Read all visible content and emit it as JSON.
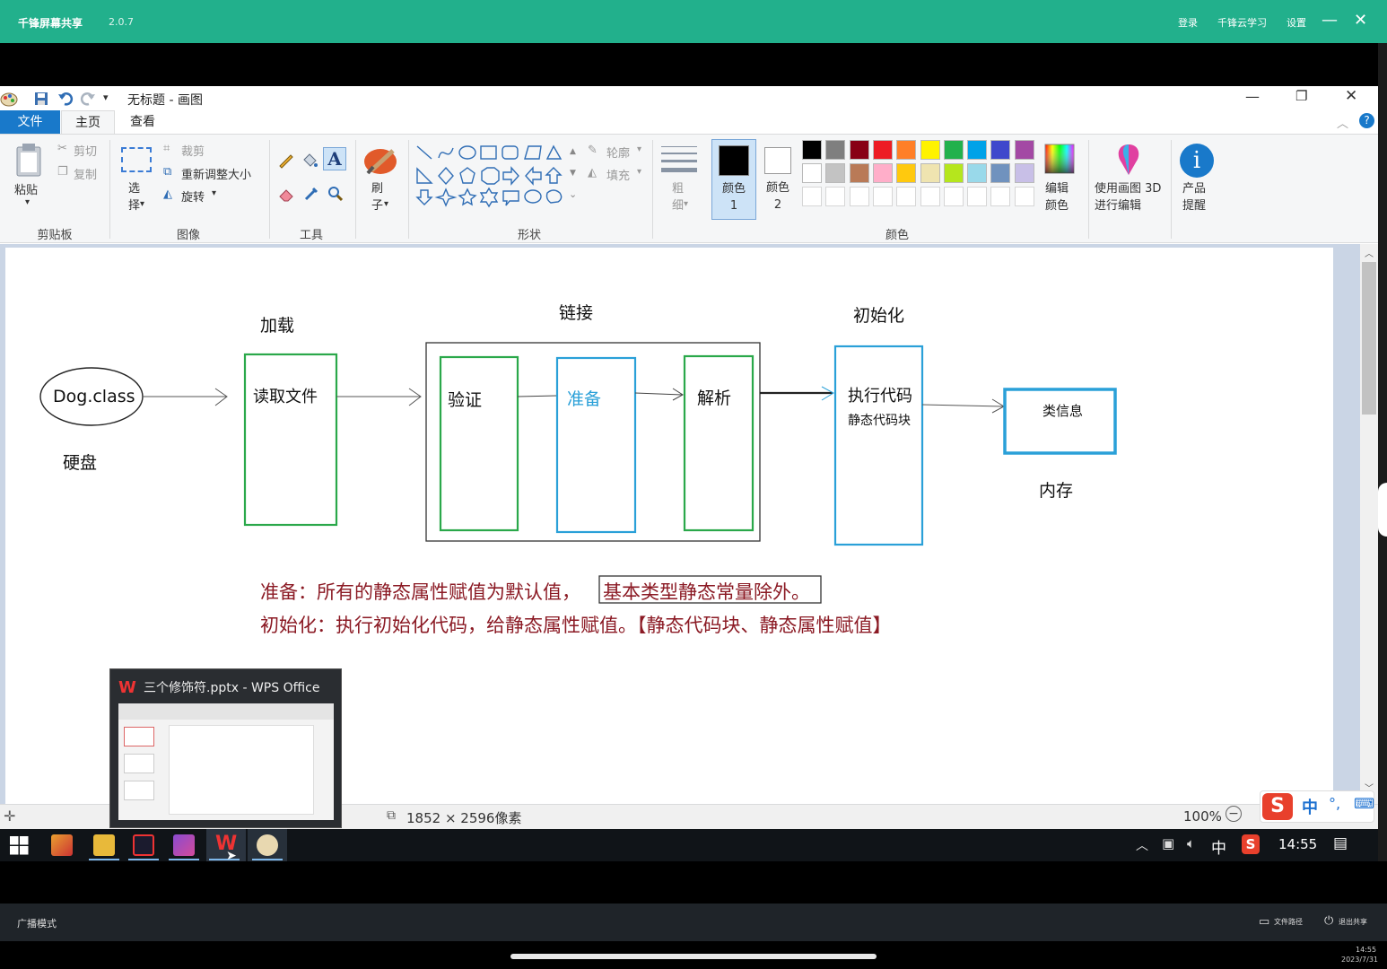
{
  "share_bar": {
    "app_name": "千锋屏幕共享",
    "version": "2.0.7",
    "links": [
      "登录",
      "千锋云学习",
      "设置"
    ],
    "minimize": "—",
    "close": "✕"
  },
  "paint": {
    "window_title": "无标题 - 画图",
    "tabs": [
      "文件",
      "主页",
      "查看"
    ],
    "clipboard": {
      "paste": "粘贴",
      "cut": "剪切",
      "copy": "复制",
      "label": "剪贴板"
    },
    "image": {
      "select": "选择",
      "crop": "裁剪",
      "resize": "重新调整大小",
      "rotate": "旋转",
      "label": "图像"
    },
    "tools_label": "工具",
    "brushes": "刷子",
    "shapes": {
      "outline": "轮廓",
      "fill": "填充",
      "label": "形状"
    },
    "size": "粗细",
    "color1": "颜色 1",
    "color2": "颜色 2",
    "edit_colors": "编辑颜色",
    "paint3d": "使用画图 3D 进行编辑",
    "product_alert": "产品提醒",
    "colors_label": "颜色",
    "palette_row1": [
      "#000000",
      "#7f7f7f",
      "#880015",
      "#ed1c24",
      "#ff7f27",
      "#fff200",
      "#22b14c",
      "#00a2e8",
      "#3f48cc",
      "#a349a4"
    ],
    "palette_row2": [
      "#ffffff",
      "#c3c3c3",
      "#b97a57",
      "#ffaec9",
      "#ffc90e",
      "#efe4b0",
      "#b5e61d",
      "#99d9ea",
      "#7092be",
      "#c8bfe7"
    ],
    "status_size": "1852 × 2596像素",
    "zoom": "100%"
  },
  "diagram": {
    "stage_load": "加载",
    "stage_link": "链接",
    "stage_init": "初始化",
    "dog_class": "Dog.class",
    "disk": "硬盘",
    "read_file": "读取文件",
    "verify": "验证",
    "prepare": "准备",
    "resolve": "解析",
    "exec_code": "执行代码",
    "static_block": "静态代码块",
    "class_info": "类信息",
    "memory": "内存",
    "note1_a": "准备：所有的静态属性赋值为默认值，",
    "note1_b": "基本类型静态常量除外。",
    "note2": "初始化：执行初始化代码，给静态属性赋值。【静态代码块、静态属性赋值】"
  },
  "taskbar": {
    "preview_title": "三个修饰符.pptx - WPS Office",
    "ime": "中",
    "time": "14:55"
  },
  "share_footer": {
    "mode": "广播模式",
    "files": "文件路径",
    "exit": "退出共享",
    "time": "14:55",
    "date": "2023/7/31"
  }
}
